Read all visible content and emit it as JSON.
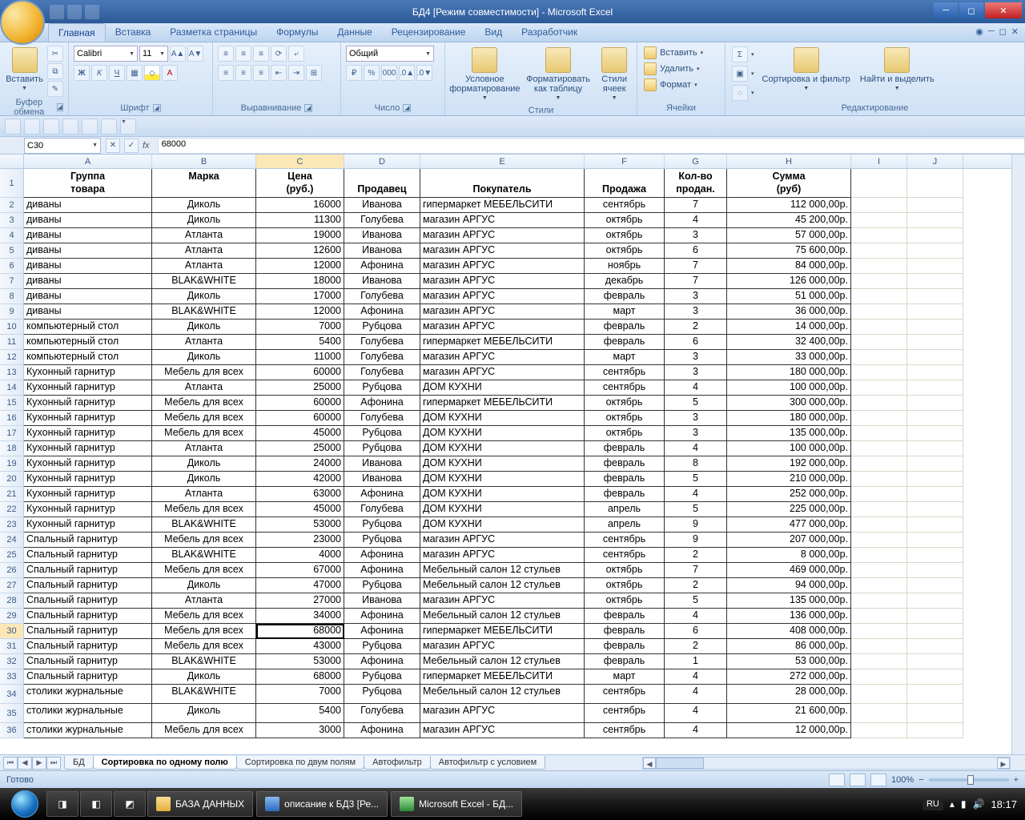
{
  "title": "БД4  [Режим совместимости] - Microsoft Excel",
  "tabs": [
    "Главная",
    "Вставка",
    "Разметка страницы",
    "Формулы",
    "Данные",
    "Рецензирование",
    "Вид",
    "Разработчик"
  ],
  "ribbon": {
    "clipboard": {
      "paste": "Вставить",
      "label": "Буфер обмена"
    },
    "font": {
      "name": "Calibri",
      "size": "11",
      "label": "Шрифт",
      "bold": "Ж",
      "italic": "К",
      "underline": "Ч"
    },
    "align": {
      "label": "Выравнивание"
    },
    "number": {
      "format": "Общий",
      "label": "Число"
    },
    "styles": {
      "cond": "Условное форматирование",
      "table": "Форматировать как таблицу",
      "cell": "Стили ячеек",
      "label": "Стили"
    },
    "cells": {
      "insert": "Вставить",
      "delete": "Удалить",
      "format": "Формат",
      "label": "Ячейки"
    },
    "edit": {
      "sort": "Сортировка и фильтр",
      "find": "Найти и выделить",
      "label": "Редактирование"
    }
  },
  "namebox": "C30",
  "formula": "68000",
  "columns": [
    "A",
    "B",
    "C",
    "D",
    "E",
    "F",
    "G",
    "H",
    "I",
    "J"
  ],
  "header1": [
    "Группа",
    "Марка",
    "Цена",
    "",
    "",
    "",
    "Кол-во",
    "Сумма"
  ],
  "header2": [
    "товара",
    "",
    "(руб.)",
    "Продавец",
    "Покупатель",
    "Продажа",
    "продан.",
    "(руб)"
  ],
  "rows": [
    [
      "диваны",
      "Диколь",
      "16000",
      "Иванова",
      "гипермаркет МЕБЕЛЬСИТИ",
      "сентябрь",
      "7",
      "112 000,00р."
    ],
    [
      "диваны",
      "Диколь",
      "11300",
      "Голубева",
      "магазин АРГУС",
      "октябрь",
      "4",
      "45 200,00р."
    ],
    [
      "диваны",
      "Атланта",
      "19000",
      "Иванова",
      "магазин АРГУС",
      "октябрь",
      "3",
      "57 000,00р."
    ],
    [
      "диваны",
      "Атланта",
      "12600",
      "Иванова",
      "магазин АРГУС",
      "октябрь",
      "6",
      "75 600,00р."
    ],
    [
      "диваны",
      "Атланта",
      "12000",
      "Афонина",
      "магазин АРГУС",
      "ноябрь",
      "7",
      "84 000,00р."
    ],
    [
      "диваны",
      "BLAK&WHITE",
      "18000",
      "Иванова",
      "магазин АРГУС",
      "декабрь",
      "7",
      "126 000,00р."
    ],
    [
      "диваны",
      "Диколь",
      "17000",
      "Голубева",
      "магазин АРГУС",
      "февраль",
      "3",
      "51 000,00р."
    ],
    [
      "диваны",
      "BLAK&WHITE",
      "12000",
      "Афонина",
      "магазин АРГУС",
      "март",
      "3",
      "36 000,00р."
    ],
    [
      "компьютерный стол",
      "Диколь",
      "7000",
      "Рубцова",
      "магазин АРГУС",
      "февраль",
      "2",
      "14 000,00р."
    ],
    [
      "компьютерный стол",
      "Атланта",
      "5400",
      "Голубева",
      "гипермаркет МЕБЕЛЬСИТИ",
      "февраль",
      "6",
      "32 400,00р."
    ],
    [
      "компьютерный стол",
      "Диколь",
      "11000",
      "Голубева",
      "магазин АРГУС",
      "март",
      "3",
      "33 000,00р."
    ],
    [
      "Кухонный гарнитур",
      "Мебель для всех",
      "60000",
      "Голубева",
      "магазин АРГУС",
      "сентябрь",
      "3",
      "180 000,00р."
    ],
    [
      "Кухонный гарнитур",
      "Атланта",
      "25000",
      "Рубцова",
      "ДОМ КУХНИ",
      "сентябрь",
      "4",
      "100 000,00р."
    ],
    [
      "Кухонный гарнитур",
      "Мебель для всех",
      "60000",
      "Афонина",
      "гипермаркет МЕБЕЛЬСИТИ",
      "октябрь",
      "5",
      "300 000,00р."
    ],
    [
      "Кухонный гарнитур",
      "Мебель для всех",
      "60000",
      "Голубева",
      "ДОМ КУХНИ",
      "октябрь",
      "3",
      "180 000,00р."
    ],
    [
      "Кухонный гарнитур",
      "Мебель для всех",
      "45000",
      "Рубцова",
      "ДОМ КУХНИ",
      "октябрь",
      "3",
      "135 000,00р."
    ],
    [
      "Кухонный гарнитур",
      "Атланта",
      "25000",
      "Рубцова",
      "ДОМ КУХНИ",
      "февраль",
      "4",
      "100 000,00р."
    ],
    [
      "Кухонный гарнитур",
      "Диколь",
      "24000",
      "Иванова",
      "ДОМ КУХНИ",
      "февраль",
      "8",
      "192 000,00р."
    ],
    [
      "Кухонный гарнитур",
      "Диколь",
      "42000",
      "Иванова",
      "ДОМ КУХНИ",
      "февраль",
      "5",
      "210 000,00р."
    ],
    [
      "Кухонный гарнитур",
      "Атланта",
      "63000",
      "Афонина",
      "ДОМ КУХНИ",
      "февраль",
      "4",
      "252 000,00р."
    ],
    [
      "Кухонный гарнитур",
      "Мебель для всех",
      "45000",
      "Голубева",
      "ДОМ КУХНИ",
      "апрель",
      "5",
      "225 000,00р."
    ],
    [
      "Кухонный гарнитур",
      "BLAK&WHITE",
      "53000",
      "Рубцова",
      "ДОМ КУХНИ",
      "апрель",
      "9",
      "477 000,00р."
    ],
    [
      "Спальный гарнитур",
      "Мебель для всех",
      "23000",
      "Рубцова",
      "магазин АРГУС",
      "сентябрь",
      "9",
      "207 000,00р."
    ],
    [
      "Спальный гарнитур",
      "BLAK&WHITE",
      "4000",
      "Афонина",
      "магазин АРГУС",
      "сентябрь",
      "2",
      "8 000,00р."
    ],
    [
      "Спальный гарнитур",
      "Мебель для всех",
      "67000",
      "Афонина",
      "Мебельный салон 12 стульев",
      "октябрь",
      "7",
      "469 000,00р."
    ],
    [
      "Спальный гарнитур",
      "Диколь",
      "47000",
      "Рубцова",
      "Мебельный салон 12 стульев",
      "октябрь",
      "2",
      "94 000,00р."
    ],
    [
      "Спальный гарнитур",
      "Атланта",
      "27000",
      "Иванова",
      "магазин АРГУС",
      "октябрь",
      "5",
      "135 000,00р."
    ],
    [
      "Спальный гарнитур",
      "Мебель для всех",
      "34000",
      "Афонина",
      "Мебельный салон 12 стульев",
      "февраль",
      "4",
      "136 000,00р."
    ],
    [
      "Спальный гарнитур",
      "Мебель для всех",
      "68000",
      "Афонина",
      "гипермаркет МЕБЕЛЬСИТИ",
      "февраль",
      "6",
      "408 000,00р."
    ],
    [
      "Спальный гарнитур",
      "Мебель для всех",
      "43000",
      "Рубцова",
      "магазин АРГУС",
      "февраль",
      "2",
      "86 000,00р."
    ],
    [
      "Спальный гарнитур",
      "BLAK&WHITE",
      "53000",
      "Афонина",
      "Мебельный салон 12 стульев",
      "февраль",
      "1",
      "53 000,00р."
    ],
    [
      "Спальный гарнитур",
      "Диколь",
      "68000",
      "Рубцова",
      "гипермаркет МЕБЕЛЬСИТИ",
      "март",
      "4",
      "272 000,00р."
    ],
    [
      "столики журнальные",
      "BLAK&WHITE",
      "7000",
      "Рубцова",
      "Мебельный салон 12 стульев",
      "сентябрь",
      "4",
      "28 000,00р."
    ],
    [
      "столики журнальные",
      "Диколь",
      "5400",
      "Голубева",
      "магазин АРГУС",
      "сентябрь",
      "4",
      "21 600,00р."
    ],
    [
      "столики журнальные",
      "Мебель для всех",
      "3000",
      "Афонина",
      "магазин АРГУС",
      "сентябрь",
      "4",
      "12 000,00р."
    ]
  ],
  "row34_height": 27,
  "sheets": [
    "БД",
    "Сортировка по одному полю",
    "Сортировка по двум полям",
    "Автофильтр",
    "Автофильтр с условием"
  ],
  "active_sheet": 1,
  "status": "Готово",
  "zoom": "100%",
  "taskbar": {
    "btn1": "БАЗА ДАННЫХ",
    "btn2": "описание к БД3 [Ре...",
    "btn3": "Microsoft Excel - БД...",
    "lang": "RU",
    "clock": "18:17"
  },
  "active_row": 30
}
